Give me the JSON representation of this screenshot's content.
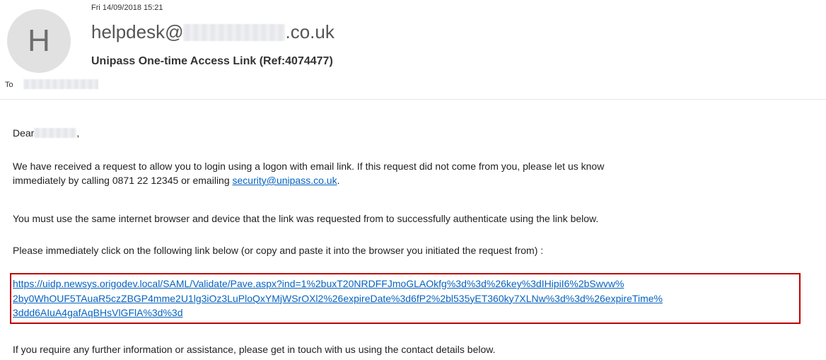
{
  "header": {
    "date": "Fri 14/09/2018 15:21",
    "sender_prefix": "helpdesk@",
    "sender_suffix": ".co.uk",
    "subject": "Unipass One-time Access Link (Ref:4074477)",
    "avatar_initial": "H",
    "to_label": "To"
  },
  "body": {
    "greeting_prefix": "Dear",
    "greeting_suffix": ",",
    "p1_line1": "We have received a request to allow you to login using a logon with email link. If this request did not come from you, please let us know",
    "p1_line2_prefix": "immediately by calling 0871 22 12345 or emailing ",
    "p1_email": "security@unipass.co.uk",
    "p1_line2_suffix": ".",
    "p2": "You must use the same internet browser and device that the link was requested from to successfully authenticate using the link below.",
    "p3": "Please immediately click on the following link below (or copy and paste it into the browser you initiated the request from) :",
    "link_line1": "https://uidp.newsys.origodev.local/SAML/Validate/Pave.aspx?ind=1%2buxT20NRDFFJmoGLAOkfg%3d%3d%26key%3dIHipiI6%2bSwvw%",
    "link_line2": "2by0WhOUF5TAuaR5czZBGP4mme2U1lg3iOz3LuPloQxYMjWSrOXl2%26expireDate%3d6fP2%2bl535yET360ky7XLNw%3d%3d%26expireTime%",
    "link_line3": "3ddd6AIuA4gafAqBHsVlGFlA%3d%3d",
    "p4": "If you require any further information or assistance, please get in touch with us using the contact details below."
  },
  "colors": {
    "link": "#0563c1",
    "highlight_border": "#c00000",
    "avatar_bg": "#e1e1e1"
  }
}
